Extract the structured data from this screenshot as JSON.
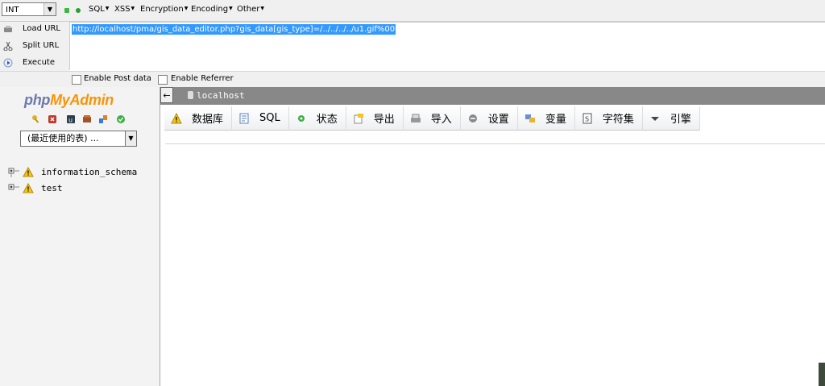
{
  "hackbar": {
    "type_select": "INT",
    "menus": [
      "SQL",
      "XSS",
      "Encryption",
      "Encoding",
      "Other"
    ],
    "actions": {
      "load_url": "Load URL",
      "split_url": "Split URL",
      "execute": "Execute"
    },
    "url": "http://localhost/pma/gis_data_editor.php?gis_data[gis_type]=/../../../../u1.gif%00",
    "enable_post": "Enable Post data",
    "enable_referrer": "Enable Referrer"
  },
  "nav": {
    "logo_php": "php",
    "logo_my": "My",
    "logo_admin": "Admin",
    "recent_select": "(最近使用的表) ...",
    "databases": [
      "information_schema",
      "test"
    ]
  },
  "server": {
    "back": "←",
    "name": "localhost"
  },
  "tabs": [
    "数据库",
    "SQL",
    "状态",
    "导出",
    "导入",
    "设置",
    "变量",
    "字符集",
    "引擎"
  ],
  "colors": {
    "hackbar_bg": "#f0f0f0",
    "url_highlight": "#3399ff",
    "server_bar": "#888888",
    "logo_php": "#6c78af",
    "logo_admin": "#f89406"
  },
  "icons": {
    "tabs": [
      "warning-icon",
      "sql-icon",
      "status-icon",
      "export-icon",
      "import-icon",
      "settings-icon",
      "variables-icon",
      "charset-icon",
      "engine-icon"
    ]
  }
}
